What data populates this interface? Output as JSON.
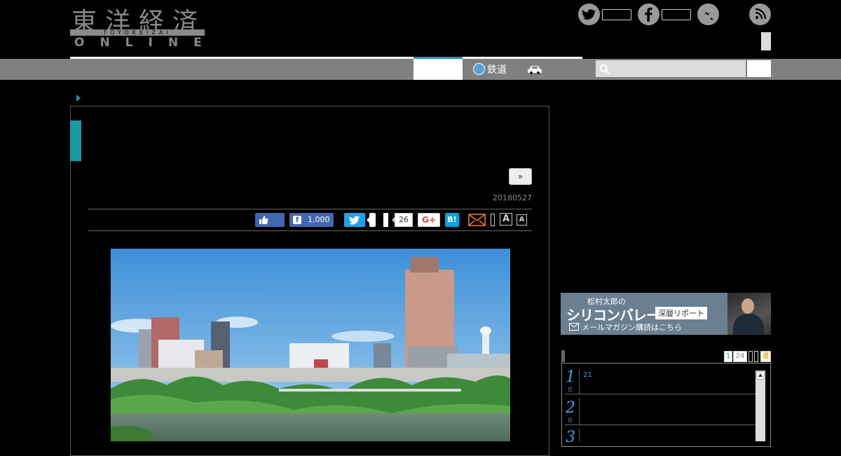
{
  "logo": {
    "kanji": "東洋経済",
    "roman": "TOYOKEIZAI",
    "online": "ONLINE"
  },
  "sns": {
    "twitter": "twitter-icon",
    "facebook": "facebook-icon",
    "messenger": "messenger-icon",
    "rss": "rss-icon"
  },
  "nav": {
    "rail_label": "鉄道"
  },
  "search": {
    "placeholder": ""
  },
  "article": {
    "next_label": "»",
    "date": "20180527",
    "share": {
      "facebook_count": "1,000",
      "pocket_count": "26",
      "gplus_label": "G+",
      "hatena_label": "B!",
      "font_large": "A",
      "font_small": "A"
    }
  },
  "sidebar": {
    "banner": {
      "author": "松村太郎の",
      "title": "シリコンバレー",
      "tag": "深層リポート",
      "mail_line": "メールマガジン購読はこちら"
    },
    "ranking": {
      "tabs": [
        "1",
        "24",
        "",
        "",
        "週"
      ],
      "items": [
        {
          "rank": "1",
          "unit": "位",
          "text": "21"
        },
        {
          "rank": "2",
          "unit": "位",
          "text": ""
        },
        {
          "rank": "3",
          "unit": "位",
          "text": ""
        }
      ]
    }
  },
  "colors": {
    "teal": "#1a9aa0",
    "nav_gray": "#808080",
    "facebook": "#4267b2",
    "twitter": "#1da1f2",
    "hatena": "#00a4de"
  }
}
